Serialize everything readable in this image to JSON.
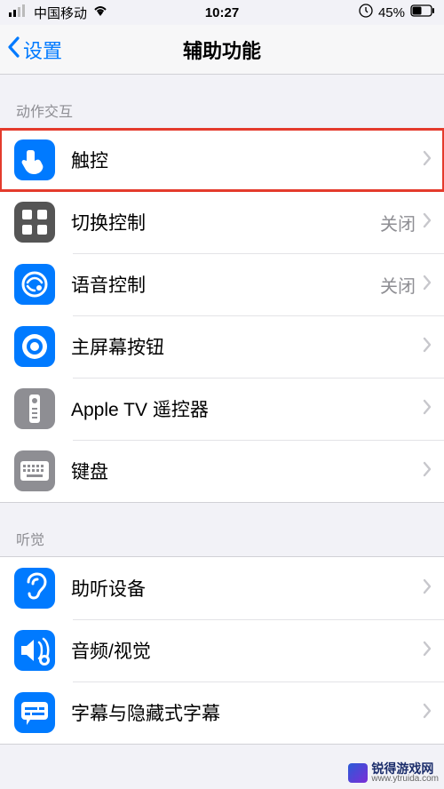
{
  "status_bar": {
    "carrier": "中国移动",
    "time": "10:27",
    "battery_pct": "45%"
  },
  "nav": {
    "back_label": "设置",
    "title": "辅助功能"
  },
  "sections": [
    {
      "header": "动作交互",
      "items": [
        {
          "icon": "touch-icon",
          "label": "触控",
          "value": "",
          "highlighted": true
        },
        {
          "icon": "switch-icon",
          "label": "切换控制",
          "value": "关闭"
        },
        {
          "icon": "voice-icon",
          "label": "语音控制",
          "value": "关闭"
        },
        {
          "icon": "home-btn-icon",
          "label": "主屏幕按钮",
          "value": ""
        },
        {
          "icon": "appletv-icon",
          "label": "Apple TV 遥控器",
          "value": ""
        },
        {
          "icon": "keyboard-icon",
          "label": "键盘",
          "value": ""
        }
      ]
    },
    {
      "header": "听觉",
      "items": [
        {
          "icon": "hearing-icon",
          "label": "助听设备",
          "value": ""
        },
        {
          "icon": "audiovisual-icon",
          "label": "音频/视觉",
          "value": ""
        },
        {
          "icon": "subtitles-icon",
          "label": "字幕与隐藏式字幕",
          "value": ""
        }
      ]
    }
  ],
  "watermark": {
    "text": "锐得游戏网",
    "url": "www.ytruida.com"
  },
  "colors": {
    "ios_blue": "#007aff",
    "ios_gray_bg": "#8e8e93",
    "highlight_red": "#e43b2c"
  }
}
